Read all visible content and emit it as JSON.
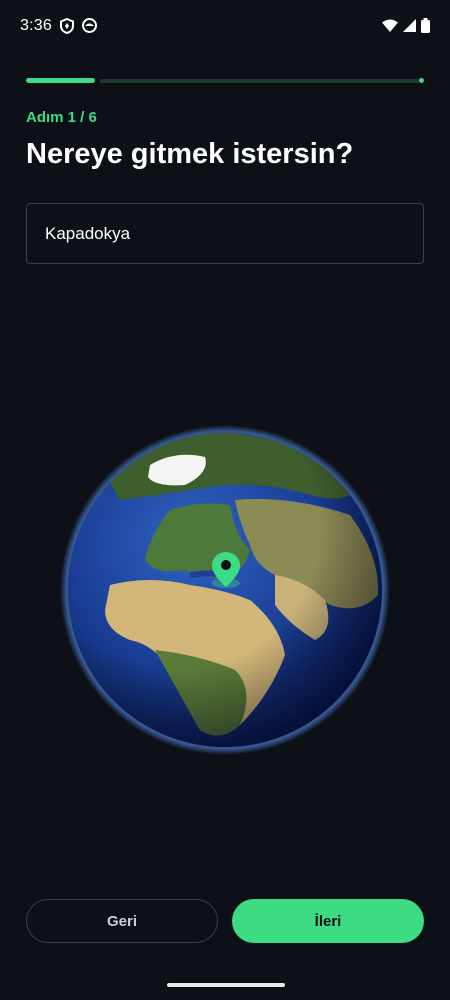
{
  "status_bar": {
    "time": "3:36",
    "left_icons": [
      "shield-icon",
      "app-notification-icon"
    ],
    "right_icons": [
      "wifi-icon",
      "cellular-signal-icon",
      "battery-icon"
    ]
  },
  "progress": {
    "current_step": 1,
    "total_steps": 6,
    "fraction": 0.17
  },
  "step_label": "Adım 1 / 6",
  "title": "Nereye gitmek istersin?",
  "destination_input": {
    "value": "Kapadokya",
    "placeholder": ""
  },
  "globe": {
    "icon": "map-pin-icon",
    "marker_location": "Kapadokya"
  },
  "buttons": {
    "back_label": "Geri",
    "next_label": "İleri"
  },
  "colors": {
    "background": "#0d1117",
    "accent": "#3ddc84",
    "border": "#3a3f48"
  }
}
